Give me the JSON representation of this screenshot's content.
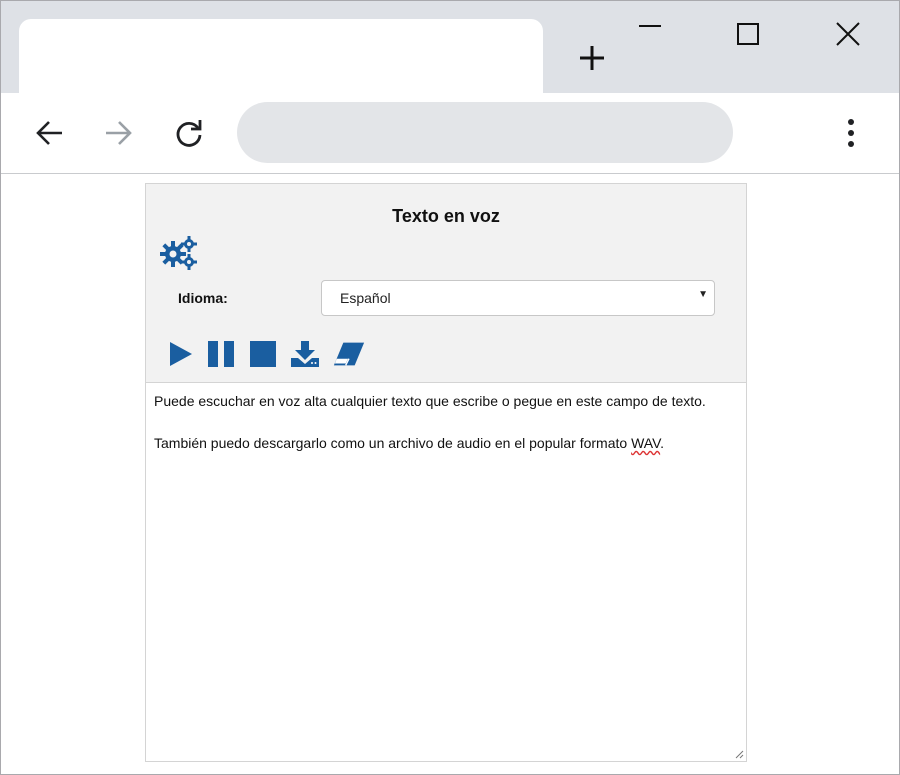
{
  "browser": {
    "tab_title": "",
    "address": "",
    "icons": {
      "new_tab": "plus-icon",
      "minimize": "minimize-icon",
      "maximize": "maximize-icon",
      "close": "close-icon",
      "back": "arrow-left-icon",
      "forward": "arrow-right-icon",
      "reload": "reload-icon",
      "menu": "kebab-menu-icon"
    }
  },
  "app": {
    "title": "Texto en voz",
    "settings_icon": "gears-icon",
    "language": {
      "label": "Idioma:",
      "selected": "Español"
    },
    "controls": {
      "play": "play-icon",
      "pause": "pause-icon",
      "stop": "stop-icon",
      "download": "download-icon",
      "erase": "eraser-icon"
    },
    "text": {
      "paragraph1": "Puede escuchar en voz alta cualquier texto que escribe o pegue en este campo de texto.",
      "paragraph2_prefix": "También puedo descargarlo como un archivo de audio en el popular formato ",
      "paragraph2_flagged": "WAV",
      "paragraph2_suffix": "."
    }
  },
  "colors": {
    "accent": "#1a5ea0",
    "tabstrip": "#dee1e6",
    "omnibox": "#e3e5e8",
    "panel_header": "#f2f2f2"
  }
}
